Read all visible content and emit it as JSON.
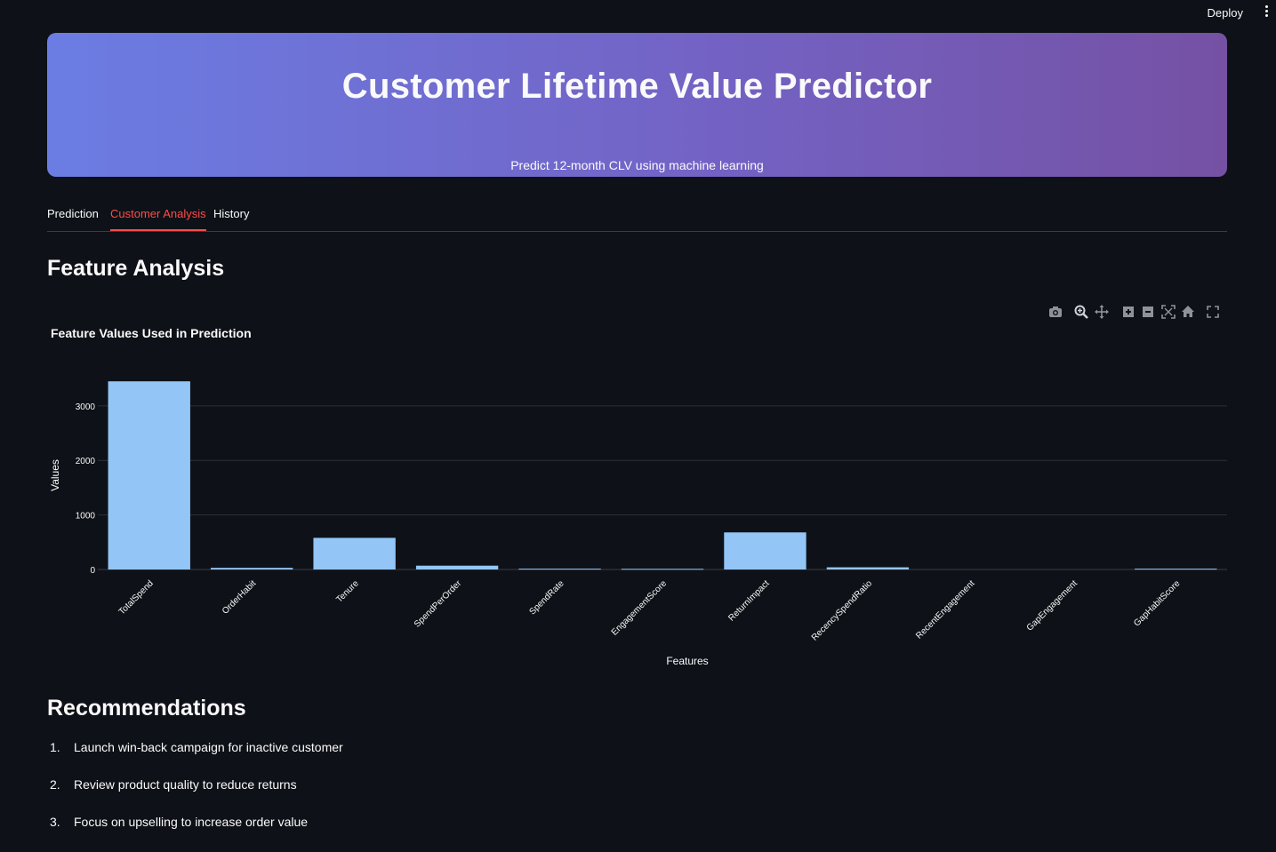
{
  "topbar": {
    "deploy_label": "Deploy"
  },
  "hero": {
    "title": "Customer Lifetime Value Predictor",
    "subtitle": "Predict 12-month CLV using machine learning"
  },
  "tabs": [
    {
      "label": "Prediction",
      "active": false
    },
    {
      "label": "Customer Analysis",
      "active": true
    },
    {
      "label": "History",
      "active": false
    }
  ],
  "feature_section": {
    "heading": "Feature Analysis"
  },
  "modebar": [
    "camera-icon",
    "zoom-icon",
    "pan-icon",
    "zoom-in-icon",
    "zoom-out-icon",
    "autoscale-icon",
    "reset-axes-icon",
    "fullscreen-icon"
  ],
  "chart_data": {
    "type": "bar",
    "title": "Feature Values Used in Prediction",
    "xlabel": "Features",
    "ylabel": "Values",
    "categories": [
      "TotalSpend",
      "OrderHabit",
      "Tenure",
      "SpendPerOrder",
      "SpendRate",
      "EngagementScore",
      "ReturnImpact",
      "RecencySpendRatio",
      "RecentEngagement",
      "GapEngagement",
      "GapHabitScore"
    ],
    "values": [
      3450,
      30,
      580,
      70,
      15,
      12,
      680,
      40,
      0,
      0,
      15
    ],
    "ylim": [
      0,
      3600
    ],
    "yticks": [
      0,
      1000,
      2000,
      3000
    ],
    "grid": true,
    "bar_color": "#93c6f7"
  },
  "recommendations": {
    "heading": "Recommendations",
    "items": [
      {
        "num": "1.",
        "text": "Launch win-back campaign for inactive customer"
      },
      {
        "num": "2.",
        "text": "Review product quality to reduce returns"
      },
      {
        "num": "3.",
        "text": "Focus on upselling to increase order value"
      }
    ]
  }
}
